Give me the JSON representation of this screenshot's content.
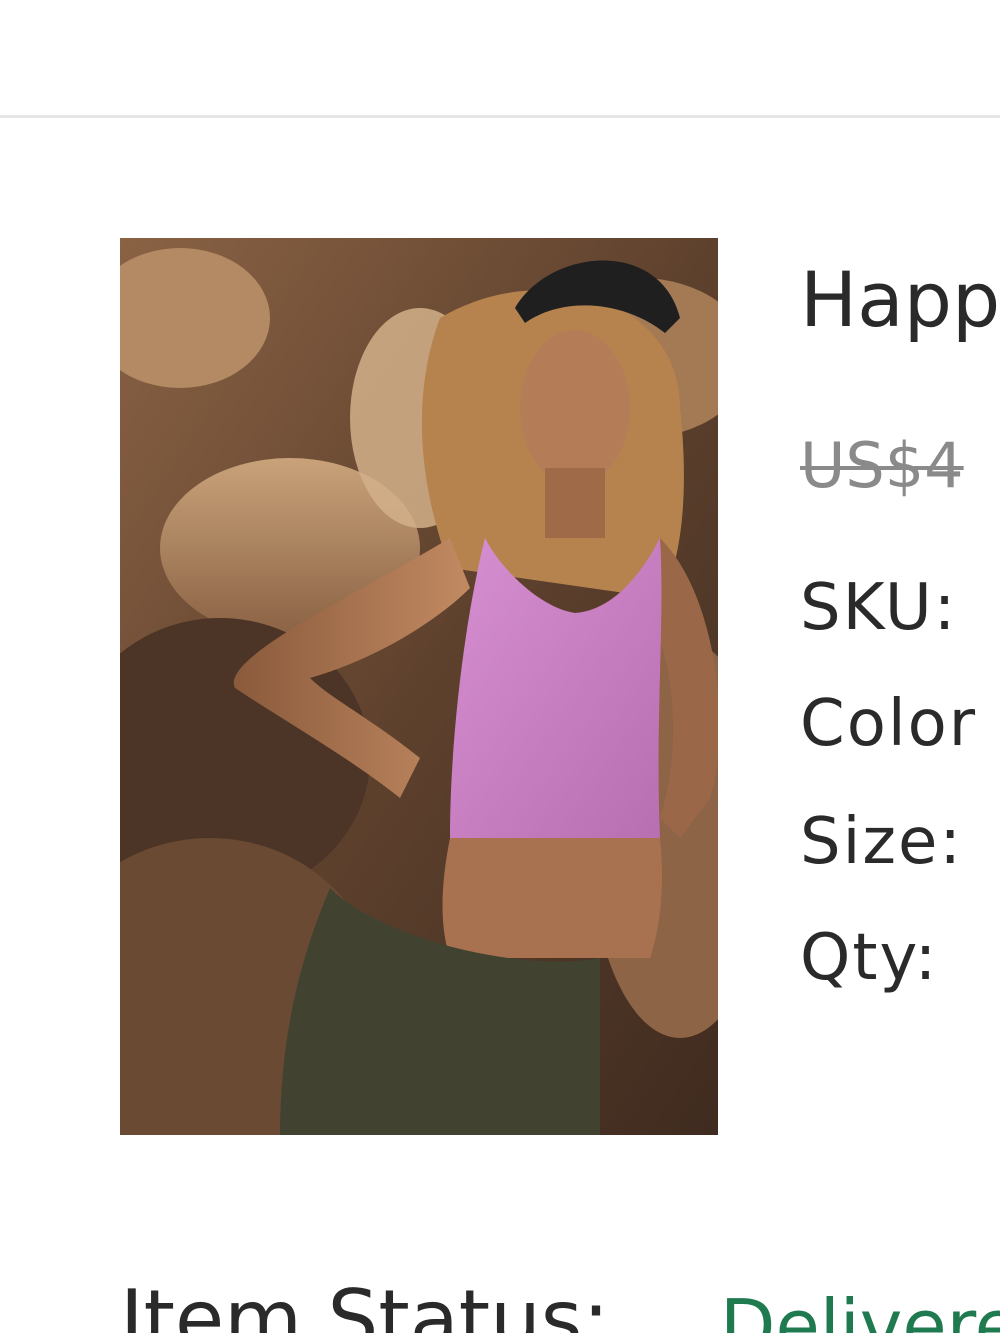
{
  "product": {
    "title": "Happ",
    "price_original": "US$4",
    "image_alt": "Model wearing pink ribbed halter crop top with olive shorts among desert rocks"
  },
  "attributes": {
    "sku_label": "SKU:",
    "color_label": "Color",
    "size_label": "Size:",
    "qty_label": "Qty:"
  },
  "status": {
    "label": "Item Status:",
    "value": "Delivere"
  },
  "colors": {
    "status_value": "#1f7a4f",
    "price_strike": "#8a8a8a",
    "divider": "#e6e6e6"
  }
}
